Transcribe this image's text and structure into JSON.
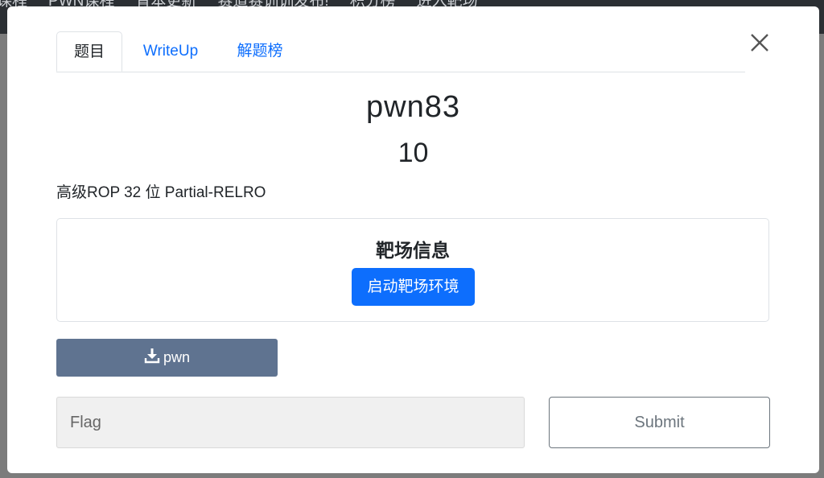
{
  "background_nav": {
    "items": [
      "课程",
      "PWN课程",
      "青本更新",
      "赛道赛训训发布!",
      "积分榜",
      "进入靶场"
    ]
  },
  "modal": {
    "tabs": [
      {
        "label": "题目",
        "active": true
      },
      {
        "label": "WriteUp",
        "active": false
      },
      {
        "label": "解题榜",
        "active": false
      }
    ],
    "close_icon": "close-x-icon",
    "challenge": {
      "title": "pwn83",
      "points": "10",
      "description": "高级ROP 32 位 Partial-RELRO"
    },
    "range_info": {
      "title": "靶场信息",
      "start_label": "启动靶场环境"
    },
    "download": {
      "icon": "download-icon",
      "label": "pwn"
    },
    "flag": {
      "placeholder": "Flag",
      "value": ""
    },
    "submit_label": "Submit"
  },
  "colors": {
    "primary": "#0d6efd",
    "download_bg": "#5f7390",
    "backdrop": "#7c7c7c"
  }
}
